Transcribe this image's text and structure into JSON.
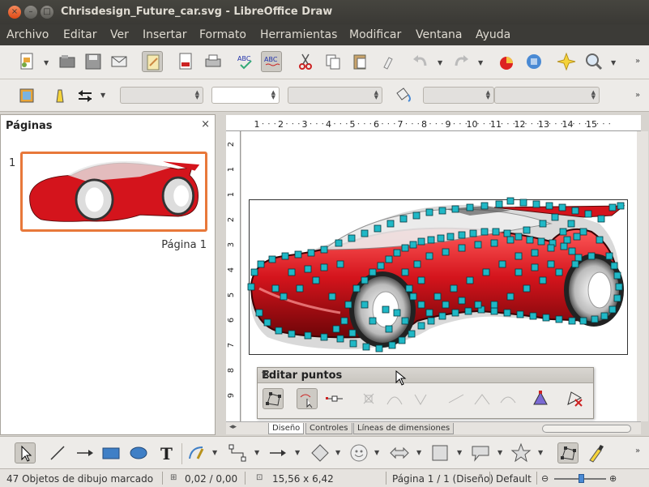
{
  "window": {
    "title": "Chrisdesign_Future_car.svg - LibreOffice Draw"
  },
  "menu": [
    "Archivo",
    "Editar",
    "Ver",
    "Insertar",
    "Formato",
    "Herramientas",
    "Modificar",
    "Ventana",
    "Ayuda"
  ],
  "pages_panel": {
    "title": "Páginas",
    "close": "×",
    "page_number": "1",
    "page_label": "Página 1"
  },
  "ruler": {
    "h_ticks": [
      "1",
      "2",
      "3",
      "4",
      "5",
      "6",
      "7",
      "8",
      "9",
      "10",
      "11",
      "12",
      "13",
      "14",
      "15"
    ],
    "v_ticks": [
      "2",
      "1",
      "1",
      "2",
      "3",
      "4",
      "5",
      "6",
      "7",
      "8",
      "9"
    ]
  },
  "tabs": [
    "Diseño",
    "Controles",
    "Líneas de dimensiones"
  ],
  "edit_points": {
    "title": "Editar puntos",
    "menu_glyph": "▾",
    "close": "×"
  },
  "status": {
    "selection": "47 Objetos de dibujo marcado",
    "position": "0,02 / 0,00",
    "size": "15,56 x 6,42",
    "page": "Página 1 / 1 (Diseño)",
    "style": "Default"
  },
  "colors": {
    "accent": "#e8783a",
    "car_red": "#d4141c",
    "handle": "#20b8c6",
    "titlebar": "#3c3b37"
  }
}
